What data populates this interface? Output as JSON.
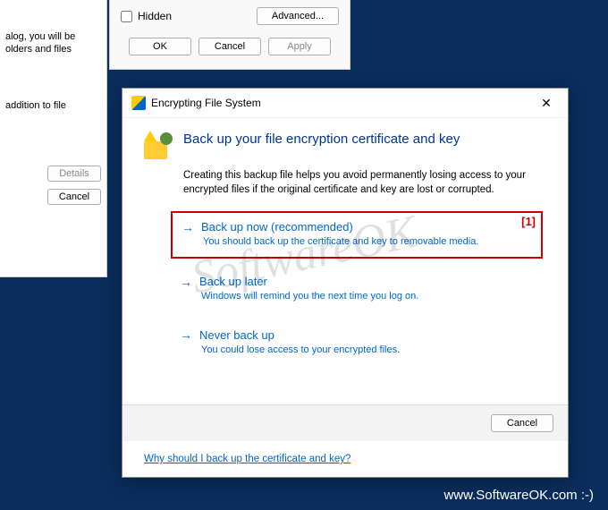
{
  "bg1": {
    "frag1": "alog, you will be\nolders and files",
    "frag2": "addition to file",
    "details_btn": "Details",
    "cancel_btn": "Cancel"
  },
  "bg2": {
    "hidden_label": "Hidden",
    "advanced_btn": "Advanced...",
    "ok_btn": "OK",
    "cancel_btn": "Cancel",
    "apply_btn": "Apply"
  },
  "efs": {
    "window_title": "Encrypting File System",
    "heading": "Back up your file encryption certificate and key",
    "desc": "Creating this backup file helps you avoid permanently losing access to your encrypted files if the original certificate and key are lost or corrupted.",
    "options": [
      {
        "title": "Back up now (recommended)",
        "sub": "You should back up the certificate and key to removable media.",
        "highlighted": true,
        "annotation": "[1]"
      },
      {
        "title": "Back up later",
        "sub": "Windows will remind you the next time you log on.",
        "highlighted": false
      },
      {
        "title": "Never back up",
        "sub": "You could lose access to your encrypted files.",
        "highlighted": false
      }
    ],
    "cancel_btn": "Cancel",
    "help_link": "Why should I back up the certificate and key?"
  },
  "watermark": {
    "diag": "SoftwareOK",
    "bottom": "www.SoftwareOK.com  :-)"
  }
}
